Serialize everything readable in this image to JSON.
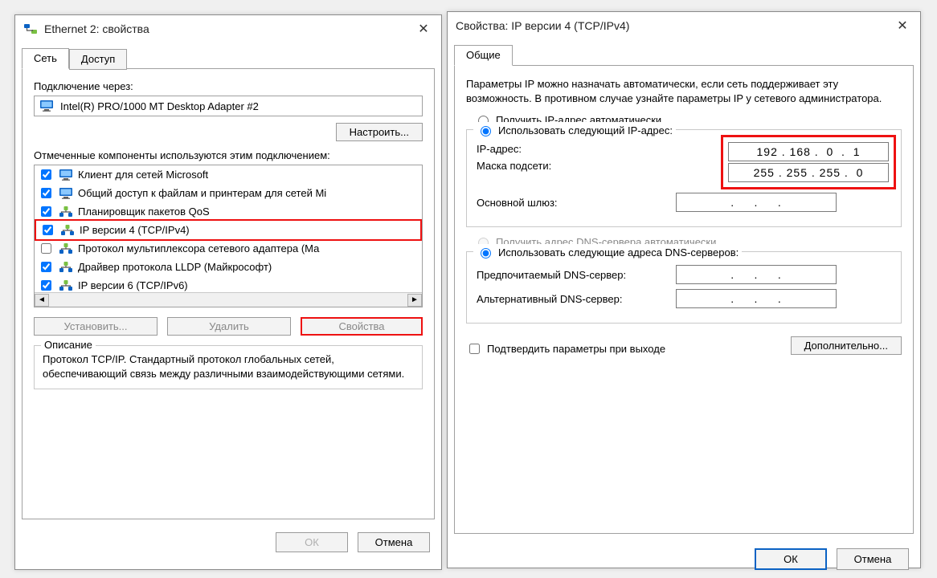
{
  "left": {
    "title": "Ethernet 2: свойства",
    "tabs": {
      "network": "Сеть",
      "access": "Доступ"
    },
    "connect_via_label": "Подключение через:",
    "adapter_name": "Intel(R) PRO/1000 MT Desktop Adapter #2",
    "configure_btn": "Настроить...",
    "components_label": "Отмеченные компоненты используются этим подключением:",
    "install_btn": "Установить...",
    "uninstall_btn": "Удалить",
    "properties_btn": "Свойства",
    "desc_legend": "Описание",
    "desc_text": "Протокол TCP/IP. Стандартный протокол глобальных сетей, обеспечивающий связь между различными взаимодействующими сетями.",
    "ok": "ОК",
    "cancel": "Отмена",
    "components": [
      {
        "label": "Клиент для сетей Microsoft",
        "checked": true
      },
      {
        "label": "Общий доступ к файлам и принтерам для сетей Mi",
        "checked": true
      },
      {
        "label": "Планировщик пакетов QoS",
        "checked": true
      },
      {
        "label": "IP версии 4 (TCP/IPv4)",
        "checked": true,
        "highlighted": true
      },
      {
        "label": "Протокол мультиплексора сетевого адаптера (Ма",
        "checked": false
      },
      {
        "label": "Драйвер протокола LLDP (Майкрософт)",
        "checked": true
      },
      {
        "label": "IP версии 6 (TCP/IPv6)",
        "checked": true
      }
    ]
  },
  "right": {
    "title": "Свойства: IP версии 4 (TCP/IPv4)",
    "tab_general": "Общие",
    "intro": "Параметры IP можно назначать автоматически, если сеть поддерживает эту возможность. В противном случае узнайте параметры IP у сетевого администратора.",
    "radio_auto_ip": "Получить IP-адрес автоматически",
    "radio_manual_ip": "Использовать следующий IP-адрес:",
    "ip_label": "IP-адрес:",
    "ip_value": "192 . 168 .  0  .  1",
    "mask_label": "Маска подсети:",
    "mask_value": "255 . 255 . 255 .  0",
    "gw_label": "Основной шлюз:",
    "gw_value": ".     .     .",
    "radio_auto_dns": "Получить адрес DNS-сервера автоматически",
    "radio_manual_dns": "Использовать следующие адреса DNS-серверов:",
    "dns1_label": "Предпочитаемый DNS-сервер:",
    "dns1_value": ".     .     .",
    "dns2_label": "Альтернативный DNS-сервер:",
    "dns2_value": ".     .     .",
    "confirm_chk": "Подтвердить параметры при выходе",
    "advanced_btn": "Дополнительно...",
    "ok": "ОК",
    "cancel": "Отмена"
  }
}
